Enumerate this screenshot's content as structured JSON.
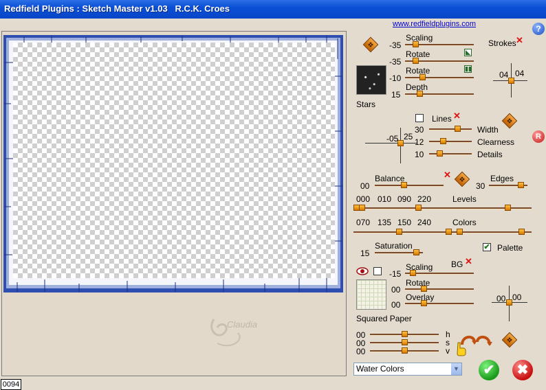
{
  "window": {
    "title": "Redfield Plugins : Sketch Master v1.03   R.C.K. Croes",
    "status": "0094"
  },
  "watermark": {
    "text": "Claudia"
  },
  "website": {
    "link": "www.redfieldplugins.com"
  },
  "help": {
    "label": "?"
  },
  "reset": {
    "label": "R"
  },
  "stars": {
    "label": "Stars",
    "scaling": {
      "label": "Scaling",
      "value": "-35",
      "level": 0.12
    },
    "rotate1": {
      "label": "Rotate",
      "value": "-35",
      "level": 0.12
    },
    "rotate2": {
      "label": "Rotate",
      "value": "-10",
      "level": 0.23
    },
    "depth": {
      "label": "Depth",
      "value": "15",
      "level": 0.19
    }
  },
  "strokes": {
    "label": "Strokes",
    "x": "04",
    "y": "04"
  },
  "lines": {
    "label": "Lines",
    "pad_x": "-05",
    "pad_y": "25",
    "width": {
      "label": "Width",
      "value": "30",
      "level": 0.69
    },
    "clearness": {
      "label": "Clearness",
      "value": "12",
      "level": 0.3
    },
    "details": {
      "label": "Details",
      "value": "10",
      "level": 0.2
    }
  },
  "balance": {
    "label": "Balance",
    "value": "00",
    "level": 0.42
  },
  "edges": {
    "label": "Edges",
    "value": "30",
    "level": 0.9
  },
  "levels": {
    "label": "Levels",
    "values": [
      "000",
      "010",
      "090",
      "220"
    ]
  },
  "colors": {
    "label": "Colors",
    "values": [
      "070",
      "135",
      "150",
      "240"
    ]
  },
  "saturation": {
    "label": "Saturation",
    "value": "15",
    "level": 0.92
  },
  "palette": {
    "label": "Palette",
    "checked": "✔"
  },
  "bg": {
    "label": "BG",
    "scaling": {
      "label": "Scaling",
      "value": "-15",
      "level": 0.08
    },
    "rotate": {
      "label": "Rotate",
      "value": "00",
      "level": 0.25
    },
    "overlay": {
      "label": "Overlay",
      "value": "00",
      "level": 0.25
    },
    "pad_x": "00",
    "pad_y": "00"
  },
  "paper": {
    "label": "Squared Paper"
  },
  "hsv": {
    "h": {
      "label": "h",
      "value": "00",
      "level": 0.5
    },
    "s": {
      "label": "s",
      "value": "00",
      "level": 0.5
    },
    "v": {
      "label": "v",
      "value": "00",
      "level": 0.5
    }
  },
  "mode": {
    "selected": "Water Colors"
  },
  "buttons": {
    "ok": "✔",
    "cancel": "✖"
  },
  "colors_theme": {
    "title": "#0a4fd6",
    "bg": "#e3dbcd",
    "knob": "#e89a10"
  }
}
